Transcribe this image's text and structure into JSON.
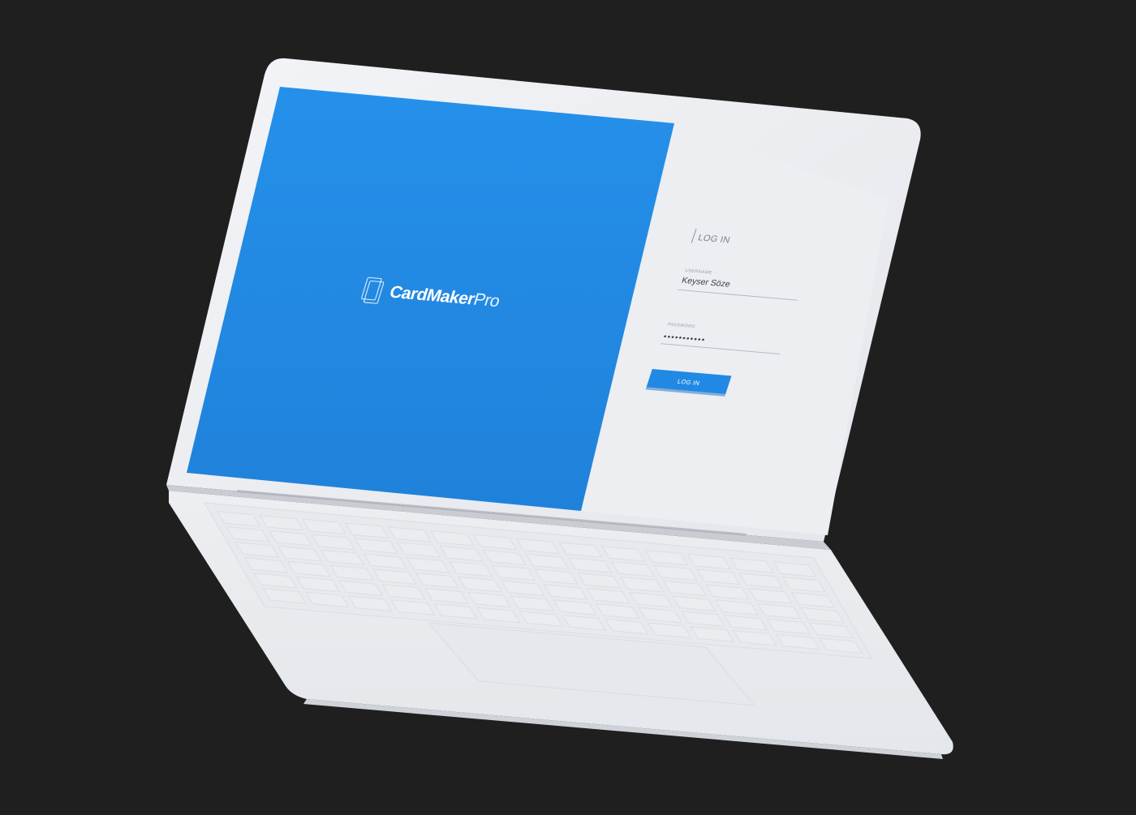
{
  "app": {
    "logo_text_bold": "CardMaker",
    "logo_text_light": "Pro"
  },
  "login": {
    "heading": "LOG IN",
    "username_label": "USERNAME",
    "username_value": "Keyser Söze",
    "password_label": "PASSWORD",
    "password_value": "•••••••••••",
    "submit_label": "LOG IN"
  },
  "colors": {
    "background": "#1f1f1f",
    "brand_blue": "#2189e4",
    "panel_bg": "#eceef2",
    "laptop_body": "#eef0f3"
  },
  "icons": {
    "logo": "card-stack-icon"
  }
}
